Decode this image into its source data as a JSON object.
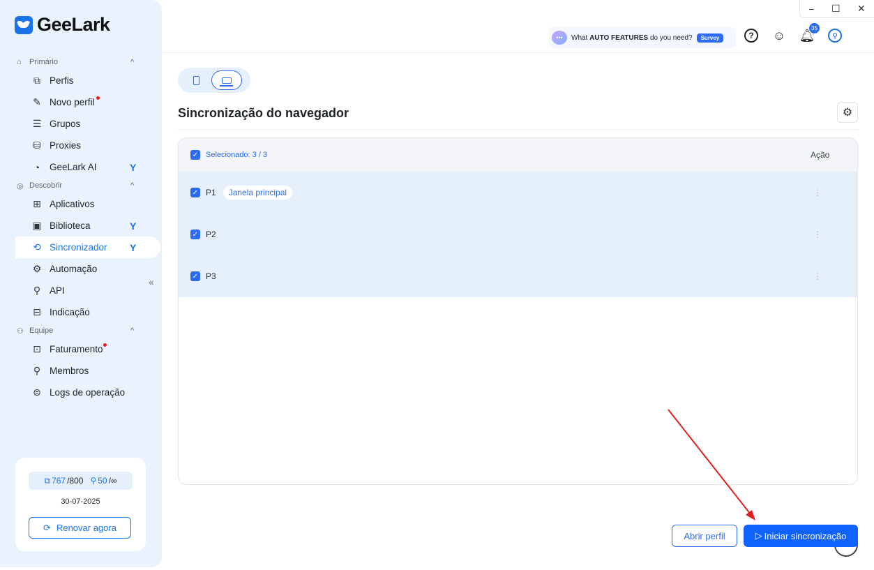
{
  "window": {
    "minimize": "−",
    "maximize": "☐",
    "close": "✕"
  },
  "logo": {
    "text": "GeeLark"
  },
  "sidebar": {
    "sections": [
      {
        "label": "Primário",
        "items": [
          {
            "label": "Perfis"
          },
          {
            "label": "Novo perfil"
          },
          {
            "label": "Grupos"
          },
          {
            "label": "Proxies"
          },
          {
            "label": "GeeLark AI"
          }
        ]
      },
      {
        "label": "Descobrir",
        "items": [
          {
            "label": "Aplicativos"
          },
          {
            "label": "Biblioteca"
          },
          {
            "label": "Sincronizador"
          },
          {
            "label": "Automação"
          },
          {
            "label": "API"
          },
          {
            "label": "Indicação"
          }
        ]
      },
      {
        "label": "Equipe",
        "items": [
          {
            "label": "Faturamento"
          },
          {
            "label": "Membros"
          },
          {
            "label": "Logs de operação"
          }
        ]
      }
    ],
    "collapse_glyph": "«"
  },
  "account": {
    "profiles_used": "767",
    "profiles_max": "/800",
    "members_used": "50",
    "members_max": "/∞",
    "date": "30-07-2025",
    "renew_label": "Renovar agora"
  },
  "survey": {
    "prefix": "What ",
    "bold": "AUTO FEATURES",
    "suffix": " do you need?",
    "button": "Survey"
  },
  "topbar": {
    "notifications_count": "35"
  },
  "main": {
    "title": "Sincronização do navegador",
    "selected_text": "Selecionado: 3 / 3",
    "action_header": "Ação",
    "rows": [
      {
        "name": "P1",
        "tag": "Janela principal"
      },
      {
        "name": "P2",
        "tag": ""
      },
      {
        "name": "P3",
        "tag": ""
      }
    ],
    "open_profile_button": "Abrir perfil",
    "start_sync_button": "Iniciar sincronização"
  },
  "colors": {
    "accent": "#2d6cf0",
    "sidebar_bg": "#eaf2fd",
    "row_bg": "#e6effc",
    "annotation_arrow": "#e02020"
  }
}
